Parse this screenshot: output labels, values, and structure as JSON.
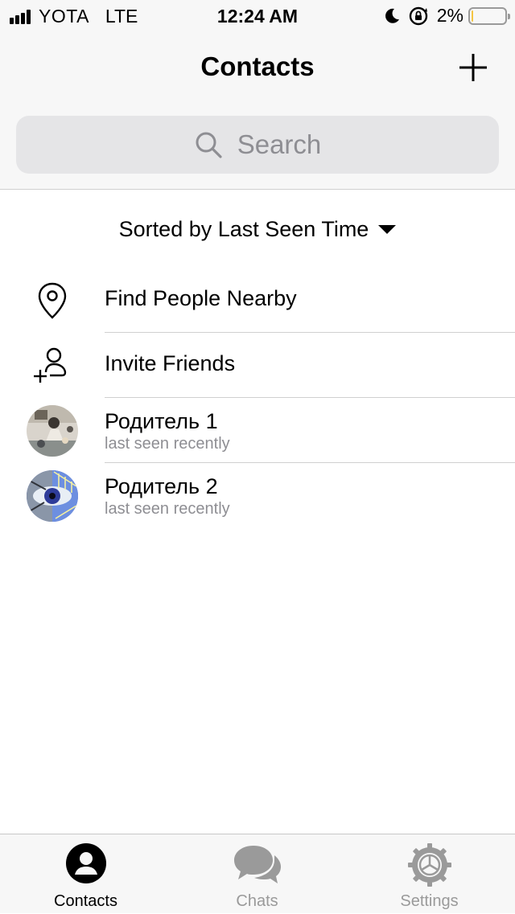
{
  "status_bar": {
    "carrier": "YOTA",
    "network": "LTE",
    "time": "12:24 AM",
    "battery_percent": "2%",
    "battery_level": 0.04,
    "icons": [
      "signal-icon",
      "moon-icon",
      "rotation-lock-icon",
      "battery-icon"
    ]
  },
  "header": {
    "title": "Contacts",
    "add_icon": "plus-icon",
    "search_placeholder": "Search"
  },
  "sort": {
    "label": "Sorted by Last Seen Time"
  },
  "actions": [
    {
      "label": "Find People Nearby",
      "icon": "location-pin-icon"
    },
    {
      "label": "Invite Friends",
      "icon": "add-person-icon"
    }
  ],
  "contacts": [
    {
      "name": "Родитель 1",
      "status": "last seen recently"
    },
    {
      "name": "Родитель 2",
      "status": "last seen recently"
    }
  ],
  "tabs": [
    {
      "label": "Contacts",
      "icon": "person-icon",
      "active": true
    },
    {
      "label": "Chats",
      "icon": "chat-bubbles-icon",
      "active": false
    },
    {
      "label": "Settings",
      "icon": "gear-icon",
      "active": false
    }
  ],
  "colors": {
    "bar_background": "#f7f7f7",
    "secondary_text": "#8e8e93",
    "inactive_tab": "#9a9a9a",
    "battery": "#f4c542"
  }
}
